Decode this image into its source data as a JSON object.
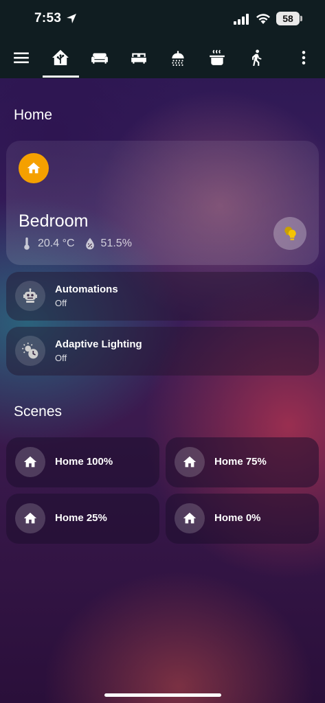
{
  "status_bar": {
    "time": "7:53",
    "battery": "58"
  },
  "navbar": {
    "tabs": [
      {
        "icon": "menu-icon"
      },
      {
        "icon": "home-assistant-icon",
        "active": true
      },
      {
        "icon": "sofa-icon"
      },
      {
        "icon": "bed-icon"
      },
      {
        "icon": "shower-icon"
      },
      {
        "icon": "pot-steam-icon"
      },
      {
        "icon": "walk-icon"
      },
      {
        "icon": "more-vert-icon"
      }
    ]
  },
  "home_section": {
    "title": "Home",
    "room_card": {
      "name": "Bedroom",
      "temperature": "20.4 °C",
      "humidity": "51.5%",
      "badge_color": "#f5a000",
      "light_color": "#f5c400"
    },
    "entities": [
      {
        "name": "Automations",
        "state": "Off",
        "icon": "robot-icon"
      },
      {
        "name": "Adaptive Lighting",
        "state": "Off",
        "icon": "sun-clock-icon"
      }
    ]
  },
  "scenes_section": {
    "title": "Scenes",
    "scenes": [
      {
        "label": "Home 100%",
        "icon": "home-icon"
      },
      {
        "label": "Home 75%",
        "icon": "home-icon"
      },
      {
        "label": "Home 25%",
        "icon": "home-icon"
      },
      {
        "label": "Home 0%",
        "icon": "home-icon"
      }
    ]
  }
}
